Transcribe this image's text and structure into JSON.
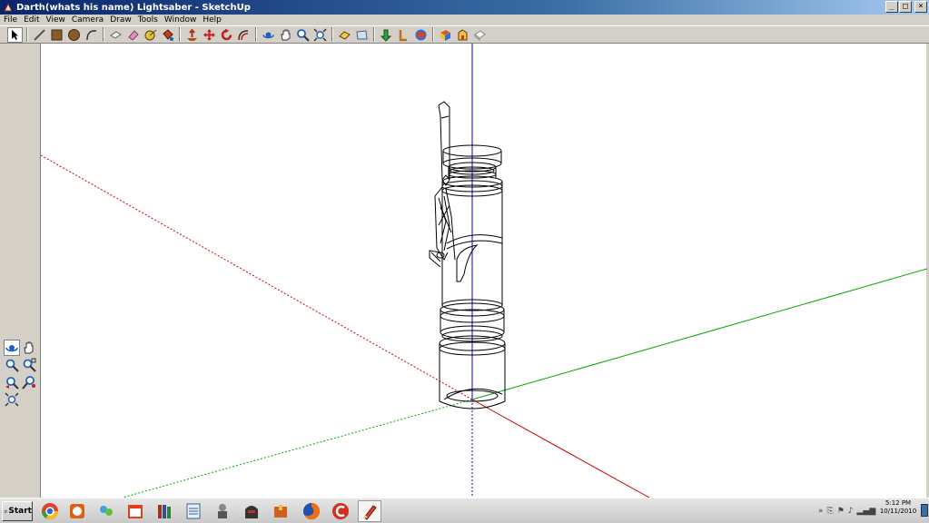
{
  "window": {
    "title": "Darth(whats his name) Lightsaber - SketchUp",
    "minimize": "_",
    "maximize": "□",
    "close": "×"
  },
  "menu": [
    "File",
    "Edit",
    "View",
    "Camera",
    "Draw",
    "Tools",
    "Window",
    "Help"
  ],
  "toolbar": {
    "icons": [
      "select-icon",
      "line-icon",
      "rectangle-icon",
      "circle-icon",
      "arc-icon",
      "make-component-icon",
      "eraser-icon",
      "tape-measure-icon",
      "paint-bucket-icon",
      "push-pull-icon",
      "move-icon",
      "rotate-icon",
      "offset-icon",
      "orbit-icon",
      "pan-icon",
      "zoom-icon",
      "zoom-extents-icon",
      "previous-view-icon",
      "next-view-icon",
      "google-earth-icon",
      "add-location-icon",
      "get-models-icon",
      "share-model-icon",
      "components-icon",
      "3d-warehouse-icon"
    ]
  },
  "taskbar": {
    "start_label": "Start",
    "clock_time": "5:12 PM",
    "clock_date": "10/11/2010"
  },
  "colors": {
    "axis_blue": "#0000cc",
    "axis_red": "#cc0000",
    "axis_green": "#00aa00",
    "title_gradient_start": "#0a246a"
  }
}
